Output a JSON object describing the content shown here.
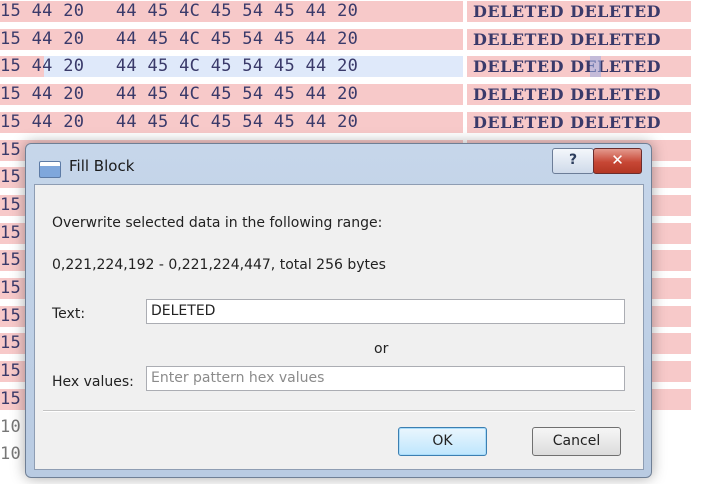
{
  "hex_editor": {
    "rows": [
      {
        "hex": "15 44 20   44 45 4C 45 54 45 44 20",
        "text": "DELETED DELETED",
        "style": "red"
      },
      {
        "hex": "15 44 20   44 45 4C 45 54 45 44 20",
        "text": "DELETED DELETED",
        "style": "red"
      },
      {
        "hex": "15 44 20   44 45 4C 45 54 45 44 20",
        "text": "DELETED DELETED",
        "style": "blue"
      },
      {
        "hex": "15 44 20   44 45 4C 45 54 45 44 20",
        "text": "DELETED DELETED",
        "style": "red"
      },
      {
        "hex": "15 44 20   44 45 4C 45 54 45 44 20",
        "text": "DELETED DELETED",
        "style": "red"
      },
      {
        "hex": "15",
        "text": "ED",
        "style": "red"
      },
      {
        "hex": "15",
        "text": "ED",
        "style": "red"
      },
      {
        "hex": "15",
        "text": "ED",
        "style": "red"
      },
      {
        "hex": "15",
        "text": "ED",
        "style": "red"
      },
      {
        "hex": "15",
        "text": "ED",
        "style": "red"
      },
      {
        "hex": "15",
        "text": "ED",
        "style": "red"
      },
      {
        "hex": "15",
        "text": "ED",
        "style": "red"
      },
      {
        "hex": "15",
        "text": "ED",
        "style": "red"
      },
      {
        "hex": "15",
        "text": "ED",
        "style": "red"
      },
      {
        "hex": "15",
        "text": "ED",
        "style": "red"
      },
      {
        "hex": "10",
        "text": ". . .",
        "style": "plain"
      },
      {
        "hex": "10",
        "text": ". . .",
        "style": "plain"
      }
    ]
  },
  "dialog": {
    "title": "Fill Block",
    "help_label": "?",
    "close_label": "✕",
    "description": "Overwrite selected data in the following range:",
    "range": "0,221,224,192 - 0,221,224,447, total 256 bytes",
    "text_label": "Text:",
    "text_value": "DELETED",
    "or_label": "or",
    "hex_label": "Hex values:",
    "hex_placeholder": "Enter pattern hex values",
    "ok_label": "OK",
    "cancel_label": "Cancel"
  }
}
